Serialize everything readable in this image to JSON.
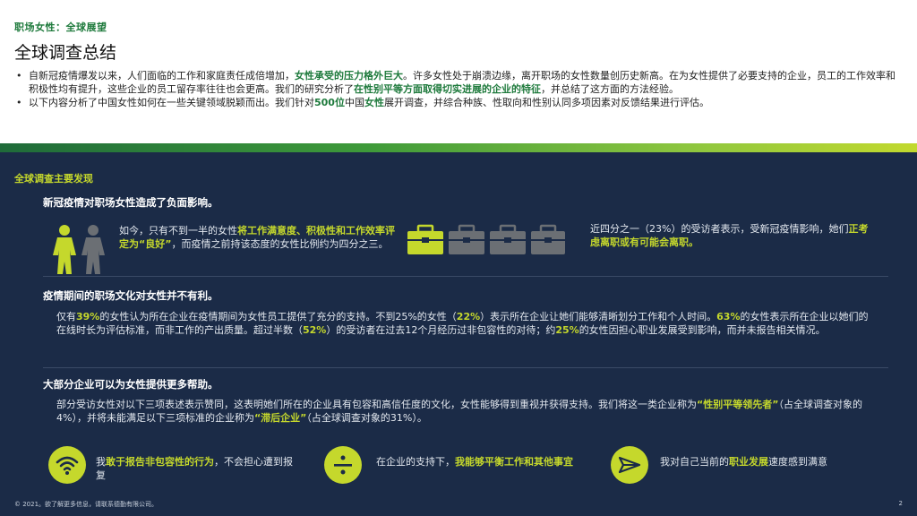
{
  "header": {
    "eyebrow": "职场女性：全球展望",
    "title": "全球调查总结"
  },
  "intro": {
    "p1_a": "自新冠疫情爆发以来，人们面临的工作和家庭责任成倍增加，",
    "p1_b": "女性承受的压力格外巨大",
    "p1_c": "。许多女性处于崩溃边缘，离开职场的女性数量创历史新高。在为女性提供了必要支持的企业，员工的工作效率和积极性均有提升，这些企业的员工留存率往往也会更高。我们的研究分析了",
    "p1_d": "在性别平等方面取得切实进展的企业的特征",
    "p1_e": "，并总结了这方面的方法经验。",
    "p2_a": "以下内容分析了中国女性如何在一些关键领域脱颖而出。我们针对",
    "p2_b": "500位",
    "p2_c": "中国",
    "p2_d": "女性",
    "p2_e": "展开调查，并综合种族、性取向和性别认同多项因素对反馈结果进行评估。"
  },
  "panel": {
    "title": "全球调查主要发现",
    "s1": {
      "heading": "新冠疫情对职场女性造成了负面影响。",
      "left_a": "如今，只有不到一半的女性",
      "left_b": "将工作满意度、积极性和工作效率评定为“良好”",
      "left_c": "，而疫情之前持该态度的女性比例约为四分之三。",
      "right_a": "近四分之一（23%）的受访者表示，受新冠疫情影响，她们",
      "right_b": "正考虑离职或有可能会离职。"
    },
    "s2": {
      "heading": "疫情期间的职场文化对女性并不有利。",
      "t1": "仅有",
      "v1": "39%",
      "t2": "的女性认为所在企业在疫情期间为女性员工提供了充分的支持。不到25%的女性（",
      "v2": "22%",
      "t3": "）表示所在企业让她们能够清晰划分工作和个人时间。",
      "v3": "63%",
      "t4": "的女性表示所在企业以她们的在线时长为评估标准，而非工作的产出质量。超过半数（",
      "v4": "52%",
      "t5": "）的受访者在过去12个月经历过非包容性的对待；约",
      "v5": "25%",
      "t6": "的女性因担心职业发展受到影响，而并未报告相关情况。"
    },
    "s3": {
      "heading": "大部分企业可以为女性提供更多帮助。",
      "t1": "部分受访女性对以下三项表述表示赞同，这表明她们所在的企业具有包容和高信任度的文化，女性能够得到重视并获得支持。我们将这一类企业称为",
      "q1": "“性别平等领先者”",
      "t2": "（占全球调查对象的4%），并将未能满足以下三项标准的企业称为",
      "q2": "“滞后企业”",
      "t3": "（占全球调查对象的31%）。"
    },
    "features": [
      {
        "icon": "wifi-icon",
        "a": "我",
        "b": "敢于报告非包容性的行为",
        "c": "，不会担心遭到报复"
      },
      {
        "icon": "divide-icon",
        "a": "在企业的支持下，",
        "b": "我能够平衡工作和其他事宜",
        "c": ""
      },
      {
        "icon": "paper-plane-icon",
        "a": "我对自己当前的",
        "b": "职业发展",
        "c": "速度感到满意"
      }
    ]
  },
  "footer": {
    "copyright": "© 2021。欲了解更多信息，请联系德勤有限公司。",
    "page": "2"
  },
  "colors": {
    "accent_green": "#1e7a3c",
    "lime": "#c5d82c",
    "navy": "#1b2b47",
    "gray_icon": "#6b6f74"
  }
}
